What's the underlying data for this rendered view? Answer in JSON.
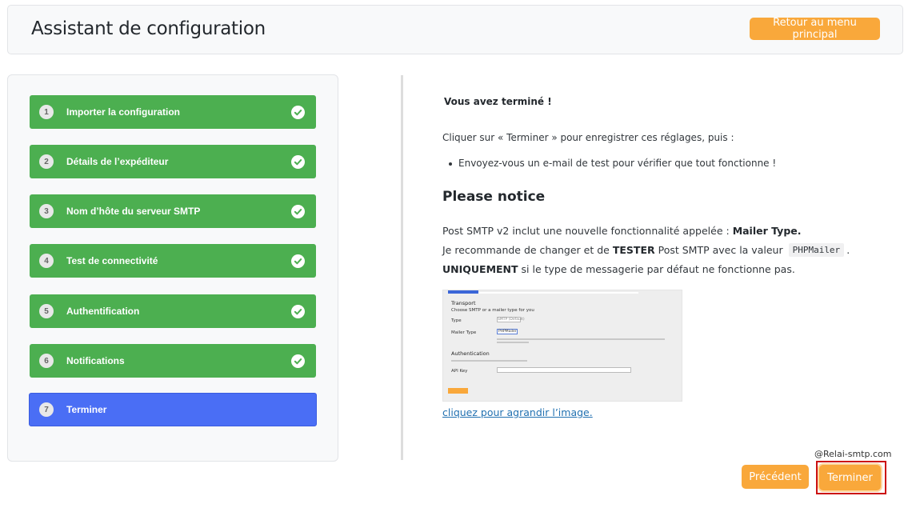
{
  "header": {
    "title": "Assistant de configuration",
    "back_label": "Retour au menu principal"
  },
  "steps": [
    {
      "number": "1",
      "label": "Importer la configuration",
      "done": true
    },
    {
      "number": "2",
      "label": "Détails de l’expéditeur",
      "done": true
    },
    {
      "number": "3",
      "label": "Nom d’hôte du serveur SMTP",
      "done": true
    },
    {
      "number": "4",
      "label": "Test de connectivité",
      "done": true
    },
    {
      "number": "5",
      "label": "Authentification",
      "done": true
    },
    {
      "number": "6",
      "label": "Notifications",
      "done": true
    },
    {
      "number": "7",
      "label": "Terminer",
      "done": false,
      "active": true
    }
  ],
  "content": {
    "finished_title": "Vous avez terminé !",
    "instructions": "Cliquer sur « Terminer » pour enregistrer ces réglages, puis :",
    "bullet": "Envoyez-vous un e-mail de test pour vérifier que tout fonctionne !",
    "notice_title": "Please notice",
    "line1_prefix": "Post SMTP v2 inclut une nouvelle fonctionnalité appelée :",
    "line1_bold": "Mailer Type.",
    "line2_prefix": "Je recommande de changer et de",
    "line2_bold": "TESTER",
    "line2_middle": "Post SMTP avec la valeur",
    "line2_code": "PHPMailer",
    "line2_suffix": ".",
    "line3_bold": "UNIQUEMENT",
    "line3_suffix": "si le type de messagerie par défaut ne fonctionne pas.",
    "image_link": "cliquez pour agrandir l’image."
  },
  "screenshot": {
    "transport": "Transport",
    "choose": "Choose SMTP or a mailer type for you",
    "type_label": "Type",
    "type_value": "SMTP (Default)",
    "mailer_label": "Mailer Type",
    "mailer_value": "PHPMailer",
    "auth": "Authentication",
    "apikey_label": "API Key"
  },
  "watermark": "@Relai-smtp.com",
  "footer": {
    "prev_label": "Précédent",
    "finish_label": "Terminer"
  },
  "colors": {
    "step_done": "#4caf50",
    "step_active": "#4a6ef5",
    "accent_orange": "#f9a83b",
    "link": "#2271b1",
    "highlight_frame": "#cc1111"
  }
}
